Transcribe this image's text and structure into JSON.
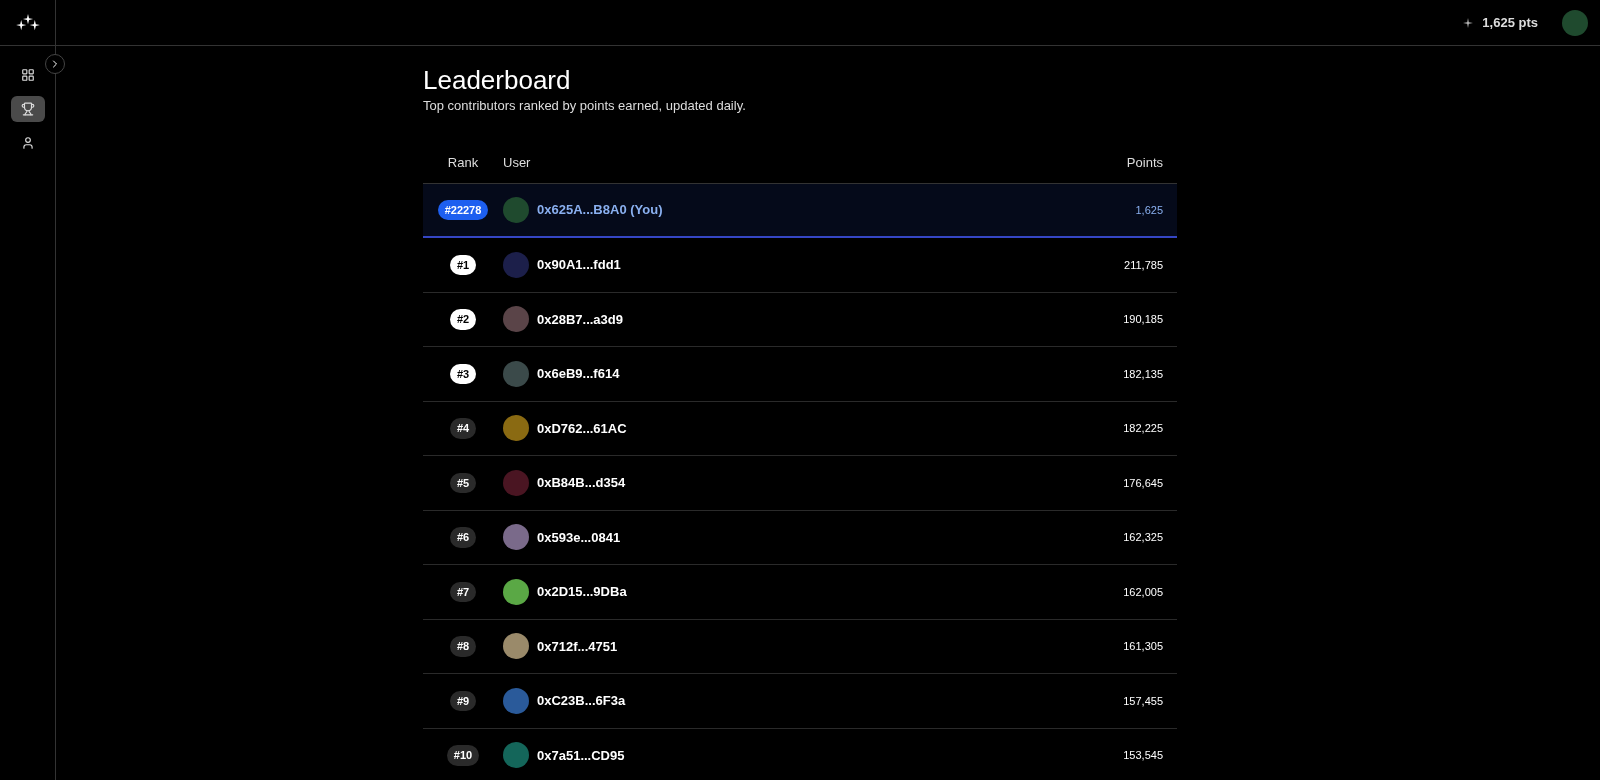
{
  "header": {
    "points": "1,625 pts"
  },
  "sidebar": {
    "items": [
      {
        "kind": "dashboard",
        "selected": false
      },
      {
        "kind": "trophy",
        "selected": true
      },
      {
        "kind": "user",
        "selected": false
      }
    ]
  },
  "page": {
    "title": "Leaderboard",
    "subtitle": "Top contributors ranked by points earned, updated daily."
  },
  "table": {
    "columns": [
      "Rank",
      "User",
      "Points"
    ],
    "rows": [
      {
        "kind": "you",
        "rank": "#22278",
        "user": "0x625A...B8A0 (You)",
        "points": "1,625",
        "color": "#1f4a2e"
      },
      {
        "kind": "top",
        "rank": "#1",
        "user": "0x90A1...fdd1",
        "points": "211,785",
        "color": "#1c1f4a"
      },
      {
        "kind": "top",
        "rank": "#2",
        "user": "0x28B7...a3d9",
        "points": "190,185",
        "color": "#5a4448"
      },
      {
        "kind": "top",
        "rank": "#3",
        "user": "0x6eB9...f614",
        "points": "182,135",
        "color": "#3b4a4a"
      },
      {
        "kind": "regular",
        "rank": "#4",
        "user": "0xD762...61AC",
        "points": "182,225",
        "color": "#8a6a12"
      },
      {
        "kind": "regular",
        "rank": "#5",
        "user": "0xB84B...d354",
        "points": "176,645",
        "color": "#4a1522"
      },
      {
        "kind": "regular",
        "rank": "#6",
        "user": "0x593e...0841",
        "points": "162,325",
        "color": "#7a6a8a"
      },
      {
        "kind": "regular",
        "rank": "#7",
        "user": "0x2D15...9DBa",
        "points": "162,005",
        "color": "#5aa845"
      },
      {
        "kind": "regular",
        "rank": "#8",
        "user": "0x712f...4751",
        "points": "161,305",
        "color": "#9a8a6a"
      },
      {
        "kind": "regular",
        "rank": "#9",
        "user": "0xC23B...6F3a",
        "points": "157,455",
        "color": "#2a5a9a"
      },
      {
        "kind": "regular",
        "rank": "#10",
        "user": "0x7a51...CD95",
        "points": "153,545",
        "color": "#14665a"
      }
    ]
  }
}
